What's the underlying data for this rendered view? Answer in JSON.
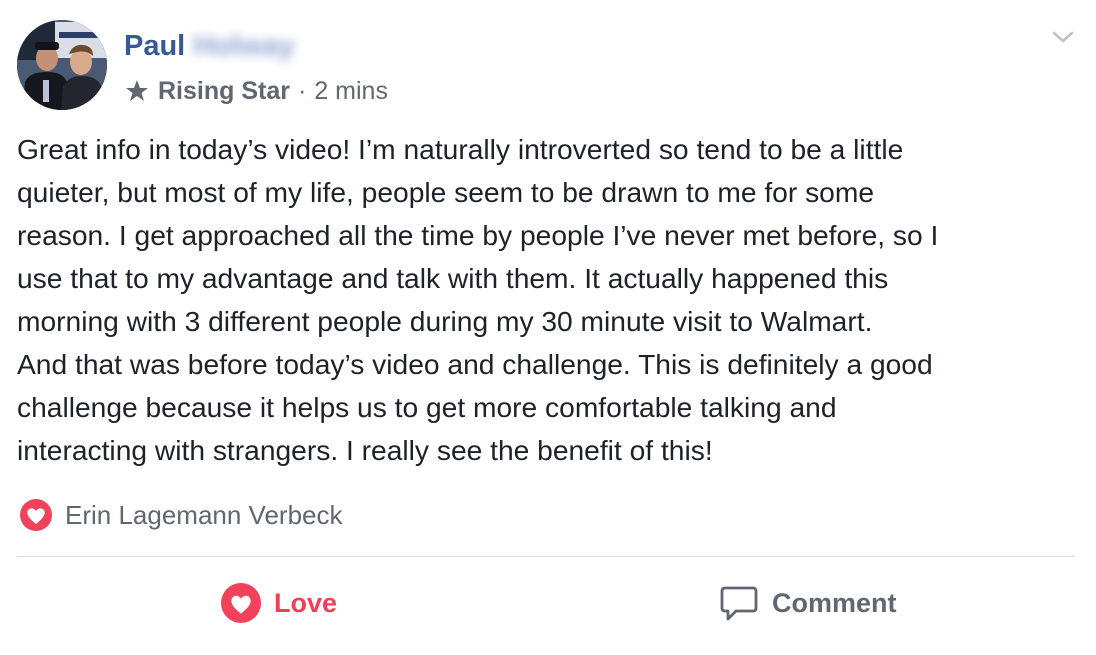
{
  "post": {
    "author": {
      "first_name": "Paul",
      "surname_obscured": "Holway"
    },
    "badge": {
      "icon": "star-icon",
      "label": "Rising Star"
    },
    "separator": "·",
    "timestamp": "2 mins",
    "options_icon": "chevron-down-icon",
    "body_text": "Great info in today’s video! I’m naturally introverted so tend to be a little\nquieter, but most of my life, people seem to be drawn to me for some\nreason. I get approached all the time by people I’ve never met before, so I\nuse that to my advantage and talk with them. It actually happened this\nmorning with 3 different people during my 30 minute visit to Walmart.\nAnd that was before today’s video and challenge. This is definitely a good\nchallenge because it helps us to get more comfortable talking and\ninteracting with strangers. I really see the benefit of this!",
    "reactions": {
      "icon": "love-reaction-icon",
      "reactor": "Erin Lagemann Verbeck"
    }
  },
  "actions": {
    "love": {
      "icon": "love-reaction-icon",
      "label": "Love"
    },
    "comment": {
      "icon": "comment-bubble-icon",
      "label": "Comment"
    }
  },
  "colors": {
    "name_link": "#385898",
    "meta_gray": "#606770",
    "body_text": "#1d2129",
    "love_red": "#f33e58",
    "divider": "#dadde1"
  }
}
